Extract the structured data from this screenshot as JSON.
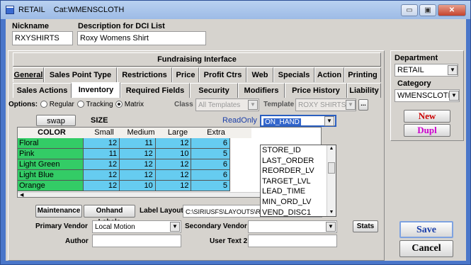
{
  "window": {
    "title": "RETAIL",
    "category_title": "Cat:WMENSCLOTH",
    "min_label": "▭",
    "max_label": "▣",
    "close_label": "✕"
  },
  "header": {
    "nickname_label": "Nickname",
    "nickname_value": "RXYSHIRTS",
    "description_label": "Description for DCI List",
    "description_value": "Roxy Womens Shirt"
  },
  "fundraising": "Fundraising Interface",
  "tabs_row1": [
    "General",
    "Sales Point Type",
    "Restrictions",
    "Price",
    "Profit Ctrs",
    "Web",
    "Specials",
    "Action",
    "Printing"
  ],
  "tabs_row2": [
    "Sales Actions",
    "Inventory",
    "Required Fields",
    "Security",
    "Modifiers",
    "Price History",
    "Liability"
  ],
  "options": {
    "label": "Options:",
    "regular": "Regular",
    "tracking": "Tracking",
    "matrix": "Matrix",
    "class_label": "Class",
    "class_value": "All Templates",
    "template_label": "Template",
    "template_value": "ROXY SHIRTS/T",
    "ellipsis": "..."
  },
  "grid": {
    "swap": "swap",
    "size_label": "SIZE",
    "color_label": "COLOR",
    "readonly_label": "ReadOnly",
    "field_selected": "ON_HAND",
    "sizes": [
      "Small",
      "Medium",
      "Large",
      "Extra Large"
    ],
    "rows": [
      {
        "color": "Floral",
        "values": [
          "12",
          "11",
          "12",
          "6"
        ]
      },
      {
        "color": "Pink",
        "values": [
          "11",
          "12",
          "10",
          "5"
        ]
      },
      {
        "color": "Light Green",
        "values": [
          "12",
          "12",
          "12",
          "6"
        ]
      },
      {
        "color": "Light Blue",
        "values": [
          "12",
          "12",
          "12",
          "6"
        ]
      },
      {
        "color": "Orange",
        "values": [
          "12",
          "10",
          "12",
          "5"
        ]
      }
    ],
    "dropdown_items": [
      "STORE_ID",
      "LAST_ORDER",
      "REORDER_LV",
      "TARGET_LVL",
      "LEAD_TIME",
      "MIN_ORD_LV",
      "VEND_DISC1"
    ]
  },
  "bottom": {
    "maintenance": "Maintenance",
    "onhand_labels": "Onhand Labels",
    "label_layout_label": "Label Layout",
    "label_layout_value": "C:\\SIRIUSFS\\LAYOUTS\\RETAIL LABELS THAT",
    "primary_vendor_label": "Primary Vendor",
    "primary_vendor_value": "Local Motion",
    "secondary_vendor_label": "Secondary Vendor",
    "secondary_vendor_value": "",
    "stats": "Stats",
    "author_label": "Author",
    "author_value": "",
    "user_text2_label": "User Text 2",
    "user_text2_value": ""
  },
  "side": {
    "department_label": "Department",
    "department_value": "RETAIL",
    "category_label": "Category",
    "category_value": "WMENSCLOTI",
    "new": "New",
    "dupl": "Dupl",
    "save": "Save",
    "cancel": "Cancel"
  },
  "colors": {
    "color_col": "#33cc66",
    "value_cells": "#66ccf0",
    "new_text": "#cc0000",
    "dupl_text": "#cc00cc",
    "save_text": "#1a3ea8"
  }
}
